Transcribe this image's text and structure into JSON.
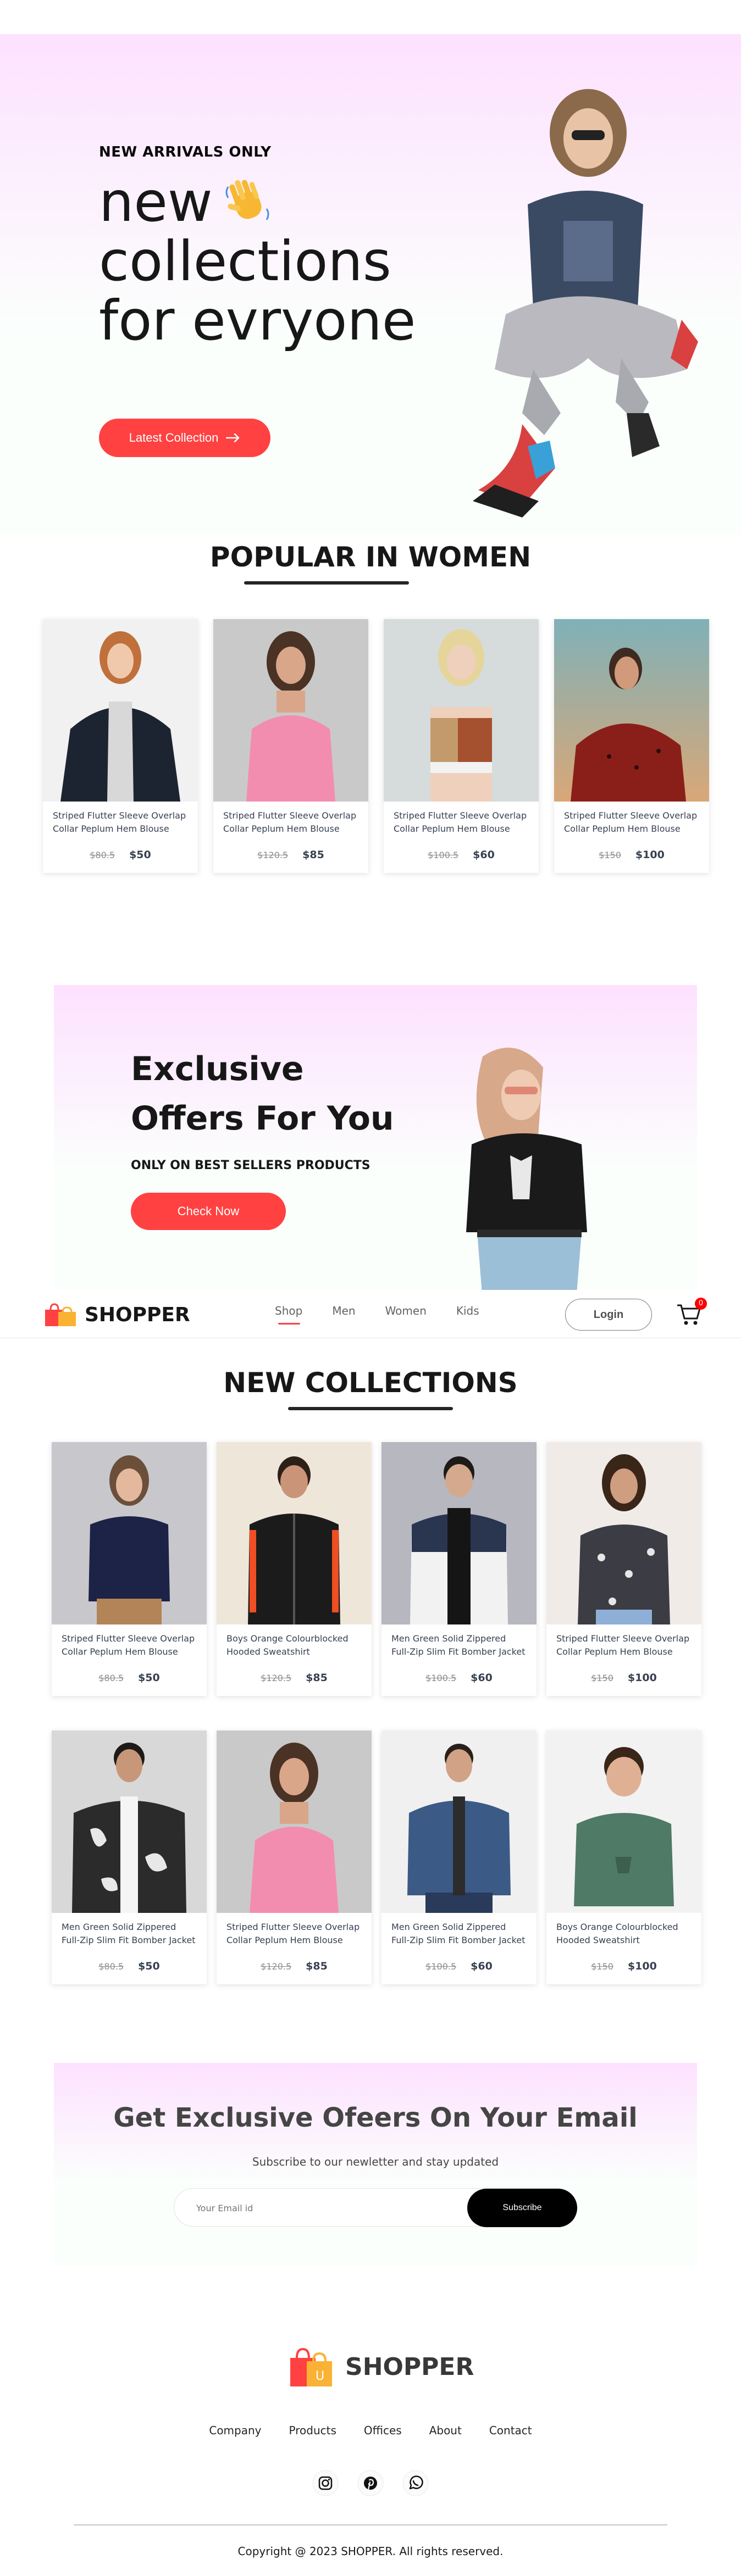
{
  "hero": {
    "tag": "NEW ARRIVALS ONLY",
    "title_lines": [
      "new",
      "collections",
      "for evryone"
    ],
    "button_label": "Latest Collection"
  },
  "popular": {
    "title": "POPULAR IN WOMEN",
    "items": [
      {
        "name": "Striped Flutter Sleeve Overlap Collar Peplum Hem Blouse",
        "old_price": "$80.5",
        "new_price": "$50"
      },
      {
        "name": "Striped Flutter Sleeve Overlap Collar Peplum Hem Blouse",
        "old_price": "$120.5",
        "new_price": "$85"
      },
      {
        "name": "Striped Flutter Sleeve Overlap Collar Peplum Hem Blouse",
        "old_price": "$100.5",
        "new_price": "$60"
      },
      {
        "name": "Striped Flutter Sleeve Overlap Collar Peplum Hem Blouse",
        "old_price": "$150",
        "new_price": "$100"
      }
    ]
  },
  "offers": {
    "title_line1": "Exclusive",
    "title_line2": "Offers For You",
    "subtitle": "ONLY ON BEST SELLERS PRODUCTS",
    "button_label": "Check Now"
  },
  "navbar": {
    "logo_text": "SHOPPER",
    "menu": [
      "Shop",
      "Men",
      "Women",
      "Kids"
    ],
    "login_label": "Login",
    "cart_count": "0"
  },
  "new_collections": {
    "title": "NEW COLLECTIONS",
    "items": [
      {
        "name": "Striped Flutter Sleeve Overlap Collar Peplum Hem Blouse",
        "old_price": "$80.5",
        "new_price": "$50"
      },
      {
        "name": "Boys Orange Colourblocked Hooded Sweatshirt",
        "old_price": "$120.5",
        "new_price": "$85"
      },
      {
        "name": "Men Green Solid Zippered Full-Zip Slim Fit Bomber Jacket",
        "old_price": "$100.5",
        "new_price": "$60"
      },
      {
        "name": "Striped Flutter Sleeve Overlap Collar Peplum Hem Blouse",
        "old_price": "$150",
        "new_price": "$100"
      },
      {
        "name": "Men Green Solid Zippered Full-Zip Slim Fit Bomber Jacket",
        "old_price": "$80.5",
        "new_price": "$50"
      },
      {
        "name": "Striped Flutter Sleeve Overlap Collar Peplum Hem Blouse",
        "old_price": "$120.5",
        "new_price": "$85"
      },
      {
        "name": "Men Green Solid Zippered Full-Zip Slim Fit Bomber Jacket",
        "old_price": "$100.5",
        "new_price": "$60"
      },
      {
        "name": "Boys Orange Colourblocked Hooded Sweatshirt",
        "old_price": "$150",
        "new_price": "$100"
      }
    ]
  },
  "newsletter": {
    "title": "Get Exclusive Ofeers On Your Email",
    "subtitle": "Subscribe to our newletter and stay updated",
    "input_placeholder": "Your Email id",
    "button_label": "Subscribe"
  },
  "footer": {
    "logo_text": "SHOPPER",
    "links": [
      "Company",
      "Products",
      "Offices",
      "About",
      "Contact"
    ],
    "social_icons": [
      "instagram-icon",
      "pinterest-icon",
      "whatsapp-icon"
    ],
    "copyright": "Copyright @ 2023 SHOPPER. All rights reserved."
  },
  "colors": {
    "accent": "#ff4141",
    "hero_gradient_top": "#fde1ff",
    "dark": "#171717"
  }
}
